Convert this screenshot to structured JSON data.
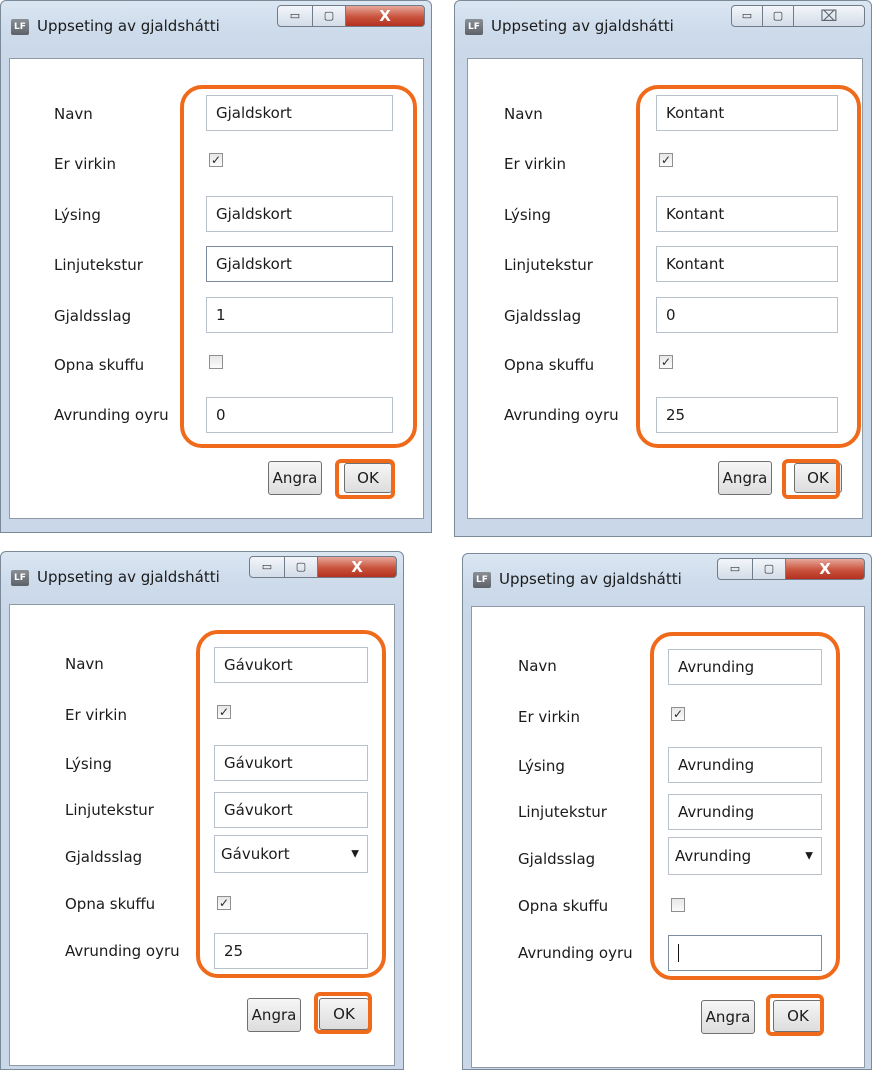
{
  "accent_color": "#ef6a1a",
  "dialogs": [
    {
      "app_icon": "LF",
      "title": "Uppseting av gjaldshátti",
      "caption": {
        "min": "▭",
        "max": "▢",
        "close": "X"
      },
      "labels": {
        "navn": "Navn",
        "er_virkin": "Er virkin",
        "lysing": "Lýsing",
        "linjutekstur": "Linjutekstur",
        "gjaldsslag": "Gjaldsslag",
        "opna_skuffu": "Opna skuffu",
        "avrunding_oyru": "Avrunding oyru"
      },
      "values": {
        "navn": "Gjaldskort",
        "er_virkin": "✓",
        "lysing": "Gjaldskort",
        "linjutekstur": "Gjaldskort",
        "gjaldsslag": "1",
        "opna_skuffu": "",
        "avrunding_oyru": "0"
      },
      "buttons": {
        "cancel": "Angra",
        "ok": "OK"
      }
    },
    {
      "app_icon": "LF",
      "title": "Uppseting av gjaldshátti",
      "caption": {
        "min": "▭",
        "max": "▢",
        "close": "⌧"
      },
      "labels": {
        "navn": "Navn",
        "er_virkin": "Er virkin",
        "lysing": "Lýsing",
        "linjutekstur": "Linjutekstur",
        "gjaldsslag": "Gjaldsslag",
        "opna_skuffu": "Opna skuffu",
        "avrunding_oyru": "Avrunding oyru"
      },
      "values": {
        "navn": "Kontant",
        "er_virkin": "✓",
        "lysing": "Kontant",
        "linjutekstur": "Kontant",
        "gjaldsslag": "0",
        "opna_skuffu": "✓",
        "avrunding_oyru": "25"
      },
      "buttons": {
        "cancel": "Angra",
        "ok": "OK"
      }
    },
    {
      "app_icon": "LF",
      "title": "Uppseting av gjaldshátti",
      "caption": {
        "min": "▭",
        "max": "▢",
        "close": "X"
      },
      "labels": {
        "navn": "Navn",
        "er_virkin": "Er virkin",
        "lysing": "Lýsing",
        "linjutekstur": "Linjutekstur",
        "gjaldsslag": "Gjaldsslag",
        "opna_skuffu": "Opna skuffu",
        "avrunding_oyru": "Avrunding oyru"
      },
      "values": {
        "navn": "Gávukort",
        "er_virkin": "✓",
        "lysing": "Gávukort",
        "linjutekstur": "Gávukort",
        "gjaldsslag": "Gávukort",
        "opna_skuffu": "✓",
        "avrunding_oyru": "25"
      },
      "buttons": {
        "cancel": "Angra",
        "ok": "OK"
      }
    },
    {
      "app_icon": "LF",
      "title": "Uppseting av gjaldshátti",
      "caption": {
        "min": "▭",
        "max": "▢",
        "close": "X"
      },
      "labels": {
        "navn": "Navn",
        "er_virkin": "Er virkin",
        "lysing": "Lýsing",
        "linjutekstur": "Linjutekstur",
        "gjaldsslag": "Gjaldsslag",
        "opna_skuffu": "Opna skuffu",
        "avrunding_oyru": "Avrunding oyru"
      },
      "values": {
        "navn": "Avrunding",
        "er_virkin": "✓",
        "lysing": "Avrunding",
        "linjutekstur": "Avrunding",
        "gjaldsslag": "Avrunding",
        "opna_skuffu": "",
        "avrunding_oyru": ""
      },
      "buttons": {
        "cancel": "Angra",
        "ok": "OK"
      }
    }
  ]
}
